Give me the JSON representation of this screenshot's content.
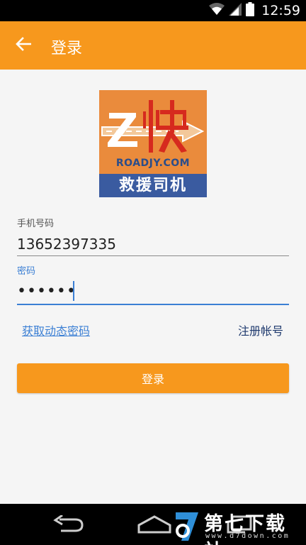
{
  "status_bar": {
    "time": "12:59",
    "icons": [
      "wifi-icon",
      "signal-icon",
      "battery-icon"
    ],
    "background": "#000000"
  },
  "app_bar": {
    "title": "登录",
    "back_icon": "arrow-back-icon",
    "color": "#f7981d"
  },
  "logo": {
    "domain": "ROADJY.COM",
    "caption": "救援司机",
    "glyph": "Z快",
    "colors": {
      "orange": "#ea8b3c",
      "blue": "#3a5ba0",
      "red": "#d62a1e"
    }
  },
  "form": {
    "phone_label": "手机号码",
    "phone_value": "13652397335",
    "password_label": "密码",
    "password_masked": "••••••",
    "dynamic_password_link": "获取动态密码",
    "register_link": "注册帐号",
    "login_button": "登录",
    "accent": "#3b7fd4"
  },
  "nav_bar": {
    "buttons": [
      "back-icon",
      "home-icon",
      "recent-apps-icon"
    ]
  },
  "watermark": {
    "text": "第七下载站",
    "url": "www.d7down.com"
  }
}
